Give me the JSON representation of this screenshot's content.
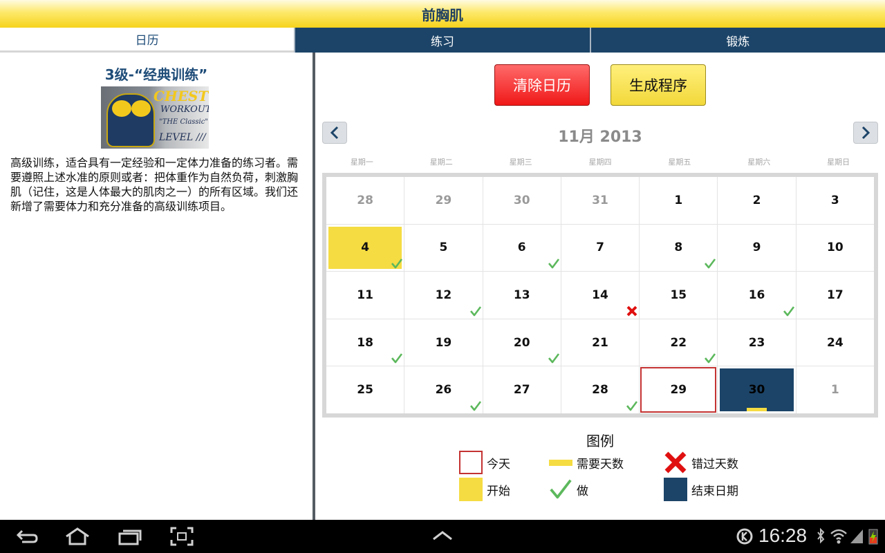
{
  "window": {
    "title": "前胸肌"
  },
  "tabs": [
    {
      "label": "日历",
      "active": true
    },
    {
      "label": "练习",
      "active": false
    },
    {
      "label": "锻炼",
      "active": false
    }
  ],
  "program": {
    "title": "3级-“经典训练”",
    "image_text": [
      "CHEST",
      "WORKOUT",
      "\"THE Classic\"",
      "LEVEL ///"
    ],
    "description": "高级训练，适合具有一定经验和一定体力准备的练习者。需要遵照上述水准的原则或者：把体重作为自然负荷，刺激胸肌（记住，这是人体最大的肌肉之一）的所有区域。我们还新增了需要体力和充分准备的高级训练项目。"
  },
  "actions": {
    "clear_label": "清除日历",
    "generate_label": "生成程序"
  },
  "calendar": {
    "month_label": "11月 2013",
    "prev_icon": "chevron-left-icon",
    "next_icon": "chevron-right-icon",
    "weekdays": [
      "星期一",
      "星期二",
      "星期三",
      "星期四",
      "星期五",
      "星期六",
      "星期日"
    ],
    "days": [
      {
        "d": "28",
        "other": true
      },
      {
        "d": "29",
        "other": true
      },
      {
        "d": "30",
        "other": true
      },
      {
        "d": "31",
        "other": true
      },
      {
        "d": "1"
      },
      {
        "d": "2"
      },
      {
        "d": "3"
      },
      {
        "d": "4",
        "state": "start",
        "mark": "done"
      },
      {
        "d": "5"
      },
      {
        "d": "6",
        "mark": "done"
      },
      {
        "d": "7"
      },
      {
        "d": "8",
        "mark": "done"
      },
      {
        "d": "9"
      },
      {
        "d": "10"
      },
      {
        "d": "11"
      },
      {
        "d": "12",
        "mark": "done"
      },
      {
        "d": "13"
      },
      {
        "d": "14",
        "mark": "missed"
      },
      {
        "d": "15"
      },
      {
        "d": "16",
        "mark": "done"
      },
      {
        "d": "17"
      },
      {
        "d": "18",
        "mark": "done"
      },
      {
        "d": "19"
      },
      {
        "d": "20",
        "mark": "done"
      },
      {
        "d": "21"
      },
      {
        "d": "22",
        "mark": "done"
      },
      {
        "d": "23"
      },
      {
        "d": "24"
      },
      {
        "d": "25"
      },
      {
        "d": "26",
        "mark": "done"
      },
      {
        "d": "27"
      },
      {
        "d": "28",
        "mark": "done"
      },
      {
        "d": "29",
        "state": "today"
      },
      {
        "d": "30",
        "state": "end",
        "need": true
      },
      {
        "d": "1",
        "other": true
      }
    ]
  },
  "legend": {
    "title": "图例",
    "today": "今天",
    "need": "需要天数",
    "missed": "错过天数",
    "start": "开始",
    "done": "做",
    "end": "结束日期"
  },
  "colors": {
    "accent_navy": "#1c4468",
    "start_yellow": "#f5dc42",
    "today_red": "#c43232",
    "done_green": "#5cb85c",
    "missed_red": "#e01010"
  },
  "statusbar": {
    "time": "16:28"
  }
}
